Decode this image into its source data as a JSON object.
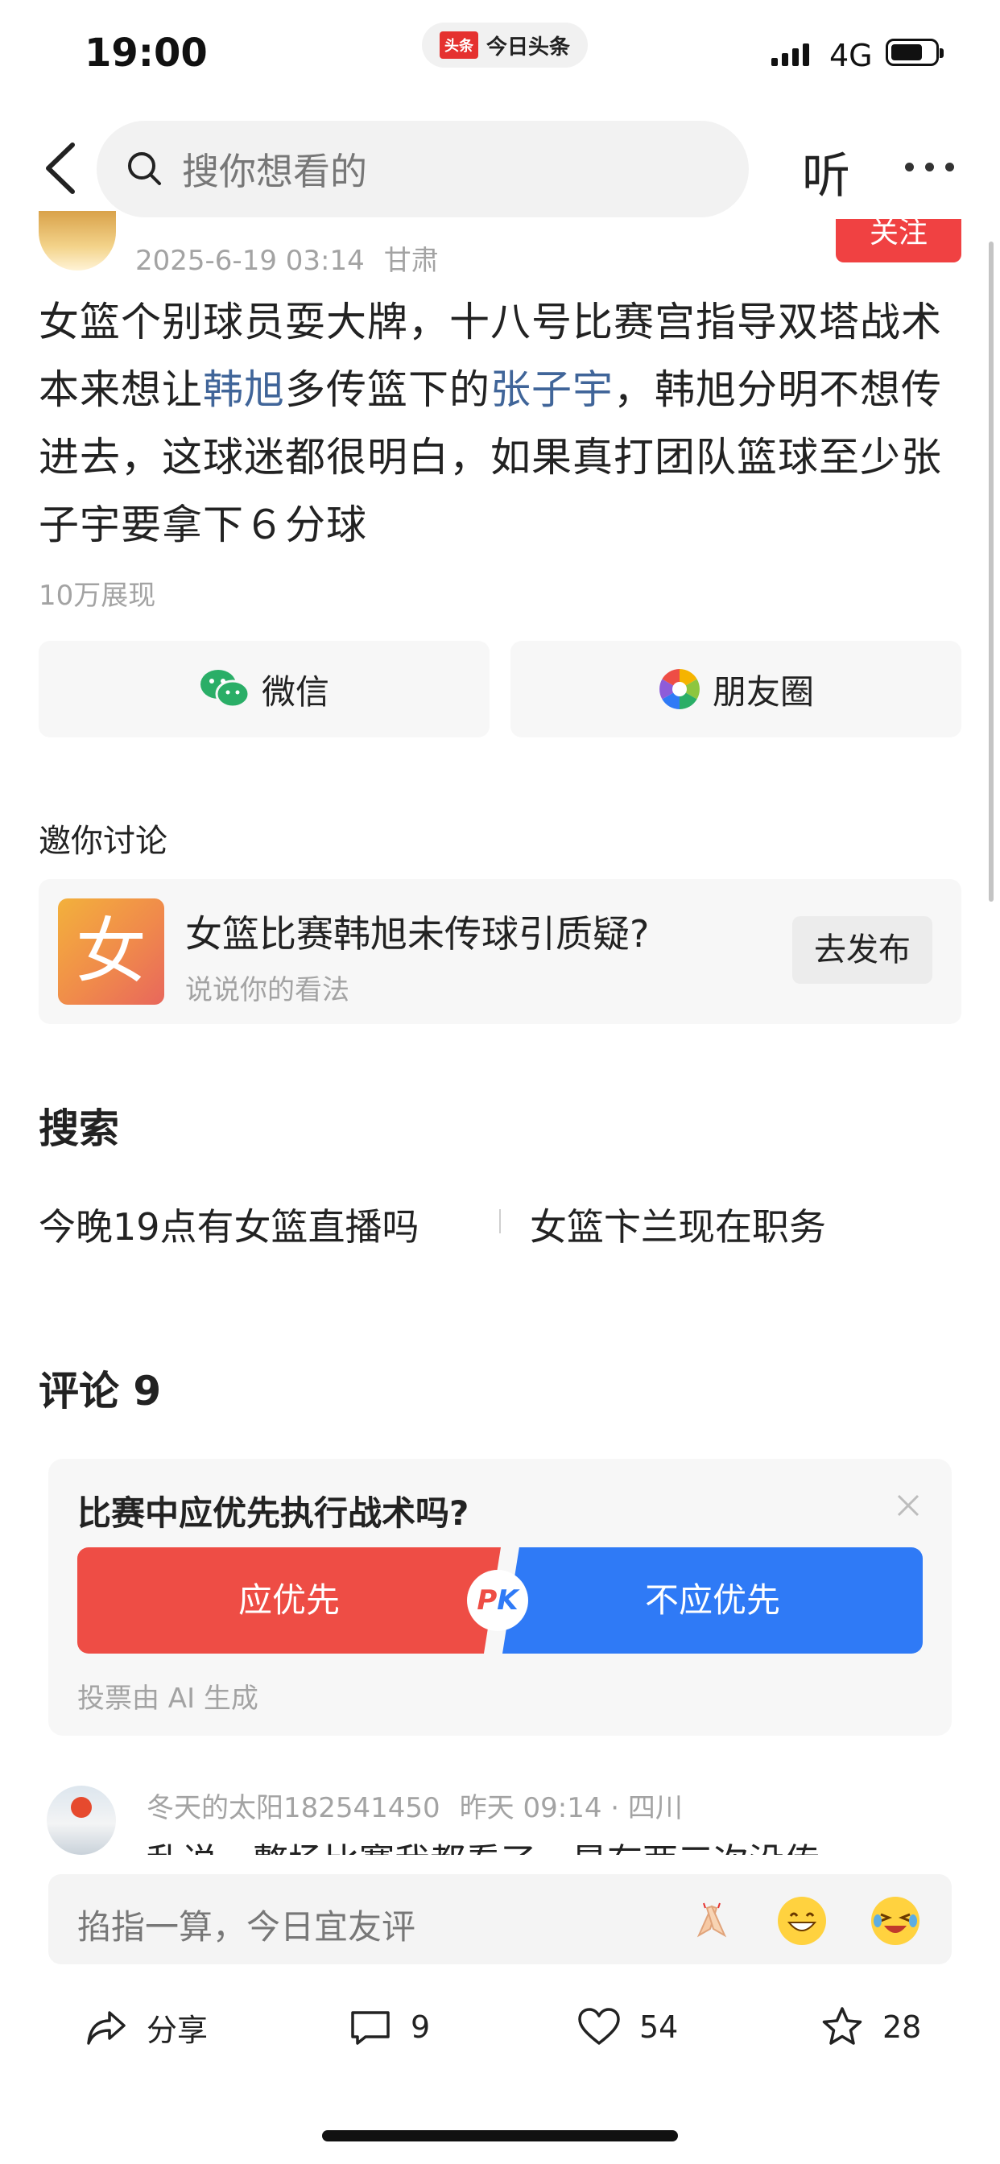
{
  "status_bar": {
    "time": "19:00",
    "app_logo": "头条",
    "app_name": "今日头条",
    "network": "4G"
  },
  "nav": {
    "search_placeholder": "搜你想看的",
    "listen_label": "听"
  },
  "post": {
    "follow_label": "关注",
    "date": "2025-6-19 03:14",
    "location": "甘肃",
    "body_parts": [
      "女篮个别球员耍大牌，十八号比赛宫指导双塔战术本来想让",
      "韩旭",
      "多传篮下的",
      "张子宇",
      "，韩旭分明不想传进去，这球迷都很明白，如果真打团队篮球至少张子宇要拿下６分球"
    ],
    "views": "10万展现"
  },
  "share": {
    "wechat_label": "微信",
    "moments_label": "朋友圈"
  },
  "discussion": {
    "section_label": "邀你讨论",
    "thumb_char": "女",
    "title": "女篮比赛韩旭未传球引质疑?",
    "subtitle": "说说你的看法",
    "post_button": "去发布"
  },
  "search": {
    "heading": "搜索",
    "suggestions": [
      "今晚19点有女篮直播吗",
      "女篮卞兰现在职务"
    ]
  },
  "comments": {
    "heading": "评论 9",
    "poll": {
      "question": "比赛中应优先执行战术吗?",
      "option_a": "应优先",
      "option_b": "不应优先",
      "pk": "PK",
      "footnote": "投票由 AI 生成"
    },
    "first": {
      "user": "冬天的太阳182541450",
      "time": "昨天 09:14 · 四川",
      "text": "乱说，整场比赛我都看了，是有两三次没传"
    }
  },
  "input": {
    "placeholder": "掐指一算，今日宜友评",
    "emojis": [
      "clap-emoji",
      "grin-emoji",
      "laugh-emoji"
    ]
  },
  "actions": {
    "share_label": "分享",
    "comments": "9",
    "likes": "54",
    "favorites": "28"
  },
  "colors": {
    "accent_red": "#f04142",
    "link_blue": "#406599",
    "poll_red": "#ee4d45",
    "poll_blue": "#2f7af6"
  }
}
